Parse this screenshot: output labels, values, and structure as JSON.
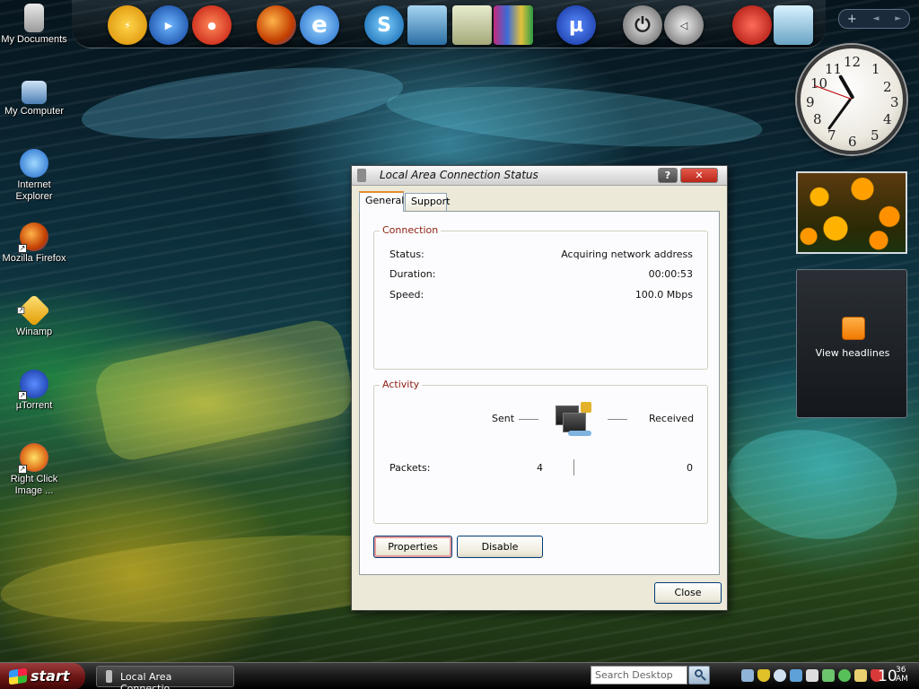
{
  "desktop": {
    "icons": [
      {
        "label": "My Documents"
      },
      {
        "label": "My Computer"
      },
      {
        "label": "Internet Explorer"
      },
      {
        "label": "Mozilla Firefox"
      },
      {
        "label": "Winamp"
      },
      {
        "label": "µTorrent"
      },
      {
        "label": "Right Click Image ..."
      }
    ]
  },
  "dock": {
    "mini_bar": {
      "plus": "+",
      "left": "◄",
      "right": "►"
    }
  },
  "gadgets": {
    "clock": {
      "numerals": [
        "12",
        "1",
        "2",
        "3",
        "4",
        "5",
        "6",
        "7",
        "8",
        "9",
        "10",
        "11"
      ]
    },
    "feed": {
      "label": "View headlines"
    }
  },
  "dialog": {
    "title": "Local Area Connection Status",
    "help_label": "?",
    "close_x": "✕",
    "tabs": [
      {
        "label": "General"
      },
      {
        "label": "Support"
      }
    ],
    "connection": {
      "title": "Connection",
      "status_label": "Status:",
      "status_value": "Acquiring network address",
      "duration_label": "Duration:",
      "duration_value": "00:00:53",
      "speed_label": "Speed:",
      "speed_value": "100.0 Mbps"
    },
    "activity": {
      "title": "Activity",
      "sent_label": "Sent",
      "received_label": "Received",
      "packets_label": "Packets:",
      "packets_sent": "4",
      "packets_received": "0"
    },
    "buttons": {
      "properties": "Properties",
      "disable": "Disable",
      "close": "Close"
    }
  },
  "taskbar": {
    "start_label": "start",
    "task_label": "Local Area Connectio...",
    "search_placeholder": "Search Desktop",
    "clock_hour": "10",
    "clock_min": "36",
    "clock_ampm": "AM"
  },
  "colors": {
    "group_title": "#8a1f11",
    "tab_highlight": "#e68b2c",
    "start_button": "#6a1414"
  }
}
